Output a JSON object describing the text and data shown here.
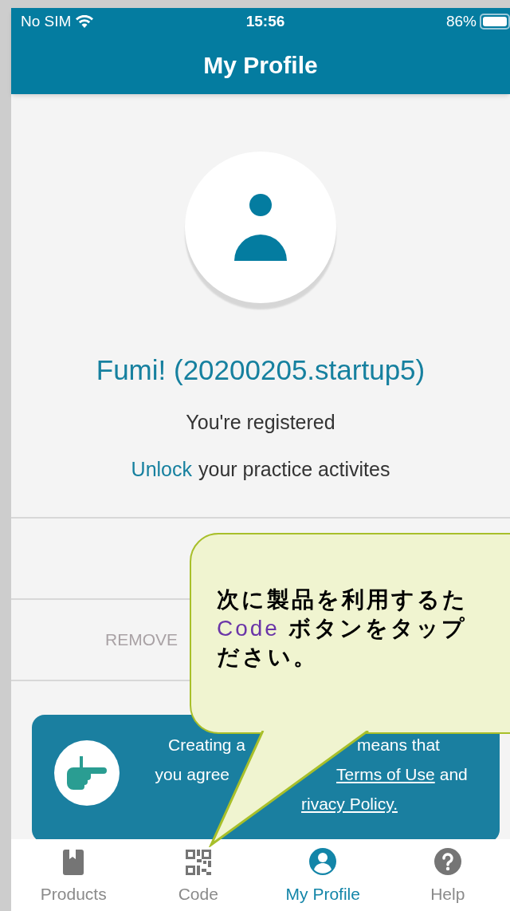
{
  "status_bar": {
    "carrier": "No SIM",
    "time": "15:56",
    "battery": "86%"
  },
  "header": {
    "title": "My Profile"
  },
  "profile": {
    "name": "Fumi! (20200205.startup5)",
    "status": "You're registered",
    "unlock_link": "Unlock",
    "unlock_text": "your practice activites"
  },
  "rows": [
    {
      "label": "REMOVE"
    }
  ],
  "notice": {
    "line_1": [
      "Creating a",
      "means that"
    ],
    "line_2": [
      "you agree",
      "Terms of Use",
      "and"
    ],
    "line_3": "rivacy Policy."
  },
  "callout": {
    "lines": [
      [
        {
          "text": "次に製品を利用するた",
          "kind": "plain"
        }
      ],
      [
        {
          "text": "Code",
          "kind": "accent"
        },
        {
          "text": " ボタンをタップ",
          "kind": "plain"
        }
      ],
      [
        {
          "text": "ださい。",
          "kind": "plain"
        }
      ]
    ]
  },
  "tabs": [
    {
      "label": "Products",
      "kind": "book",
      "selected": false
    },
    {
      "label": "Code",
      "kind": "qr",
      "selected": false
    },
    {
      "label": "My Profile",
      "kind": "person",
      "selected": true
    },
    {
      "label": "Help",
      "kind": "help",
      "selected": false
    }
  ]
}
